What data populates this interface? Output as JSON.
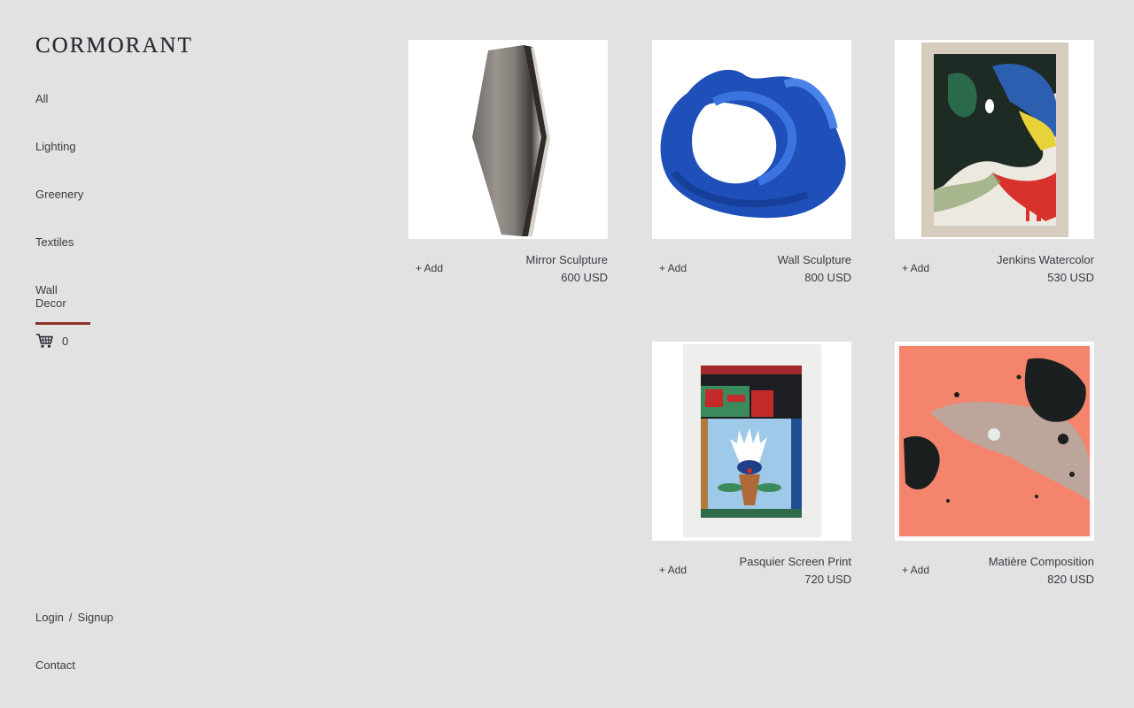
{
  "brand": "CORMORANT",
  "nav": {
    "items": [
      {
        "label": "All"
      },
      {
        "label": "Lighting"
      },
      {
        "label": "Greenery"
      },
      {
        "label": "Textiles"
      },
      {
        "label": "Wall Decor"
      }
    ],
    "active": "Wall Decor"
  },
  "cart": {
    "icon": "cart-icon",
    "count": "0"
  },
  "account": {
    "login": "Login",
    "separator": "/",
    "signup": "Signup"
  },
  "contact": "Contact",
  "products": [
    {
      "name": "Mirror Sculpture",
      "price": "600 USD",
      "add_label": "+ Add"
    },
    {
      "name": "Wall Sculpture",
      "price": "800 USD",
      "add_label": "+ Add"
    },
    {
      "name": "Jenkins Watercolor",
      "price": "530 USD",
      "add_label": "+ Add"
    },
    {
      "name": "Pasquier Screen Print",
      "price": "720 USD",
      "add_label": "+ Add"
    },
    {
      "name": "Matière Composition",
      "price": "820 USD",
      "add_label": "+ Add"
    }
  ],
  "colors": {
    "background": "#e2e2e2",
    "active_underline": "#8e2f2b",
    "text": "#3a3a44"
  }
}
